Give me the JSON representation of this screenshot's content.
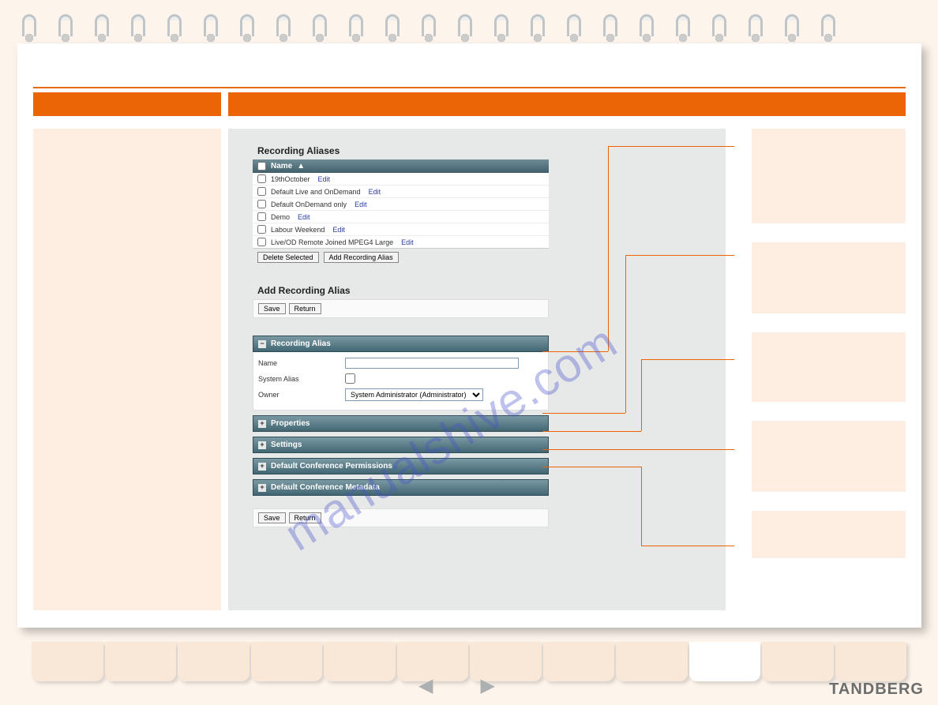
{
  "brand": "TANDBERG",
  "watermark": "manualshive.com",
  "recordingAliases": {
    "title": "Recording Aliases",
    "header": "Name",
    "rows": [
      {
        "name": "19thOctober"
      },
      {
        "name": "Default Live and OnDemand"
      },
      {
        "name": "Default OnDemand only"
      },
      {
        "name": "Demo"
      },
      {
        "name": "Labour Weekend"
      },
      {
        "name": "Live/OD Remote Joined MPEG4 Large"
      }
    ],
    "editLabel": "Edit",
    "deleteBtn": "Delete Selected",
    "addBtn": "Add Recording Alias"
  },
  "addAlias": {
    "title": "Add Recording Alias",
    "save": "Save",
    "return": "Return",
    "sections": {
      "recordingAlias": "Recording Alias",
      "properties": "Properties",
      "settings": "Settings",
      "permissions": "Default Conference Permissions",
      "metadata": "Default Conference Metadata"
    },
    "fields": {
      "name": "Name",
      "nameValue": "",
      "systemAlias": "System Alias",
      "owner": "Owner",
      "ownerValue": "System Administrator (Administrator)"
    }
  }
}
